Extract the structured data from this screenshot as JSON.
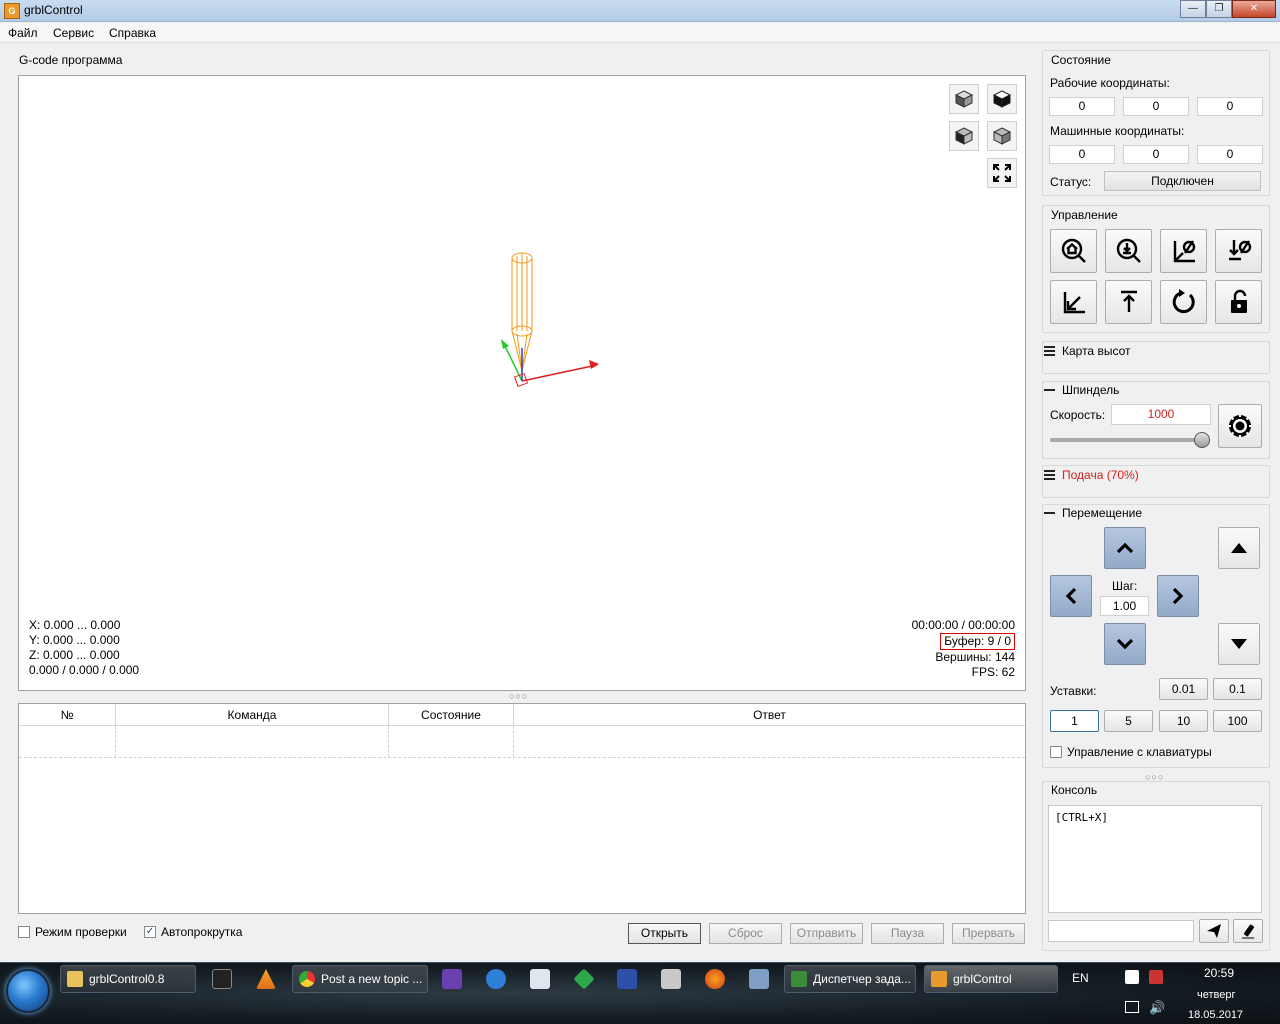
{
  "window": {
    "title": "grblControl",
    "icon_text": "G"
  },
  "menu": {
    "file": "Файл",
    "service": "Сервис",
    "help": "Справка"
  },
  "gcode": {
    "label": "G-code программа",
    "info_left": {
      "x": "X: 0.000 ... 0.000",
      "y": "Y: 0.000 ... 0.000",
      "z": "Z: 0.000 ... 0.000",
      "sizes": "0.000 / 0.000 / 0.000"
    },
    "info_right": {
      "time": "00:00:00 / 00:00:00",
      "buffer": "Буфер: 9 / 0",
      "vertices": "Вершины: 144",
      "fps": "FPS: 62"
    }
  },
  "table": {
    "columns": [
      "№",
      "Команда",
      "Состояние",
      "Ответ"
    ]
  },
  "bottom": {
    "check_mode": "Режим проверки",
    "autoscroll": "Автопрокрутка",
    "autoscroll_checked": true,
    "buttons": {
      "open": "Открыть",
      "reset": "Сброс",
      "send": "Отправить",
      "pause": "Пауза",
      "abort": "Прервать"
    }
  },
  "state": {
    "title": "Состояние",
    "work_label": "Рабочие координаты:",
    "work_coords": [
      "0",
      "0",
      "0"
    ],
    "machine_label": "Машинные координаты:",
    "machine_coords": [
      "0",
      "0",
      "0"
    ],
    "status_label": "Статус:",
    "status_value": "Подключен"
  },
  "control": {
    "title": "Управление"
  },
  "heightmap": {
    "title": "Карта высот"
  },
  "spindle": {
    "title": "Шпиндель",
    "speed_label": "Скорость:",
    "speed_value": "1000",
    "slider_fraction": 1.0
  },
  "feed": {
    "title": "Подача (70%)"
  },
  "jog": {
    "title": "Перемещение",
    "step_label": "Шаг:",
    "step_value": "1.00",
    "presets_label": "Уставки:",
    "presets_top": [
      "0.01",
      "0.1"
    ],
    "presets_bottom": [
      "1",
      "5",
      "10",
      "100"
    ],
    "keyboard_label": "Управление с клавиатуры"
  },
  "console": {
    "title": "Консоль",
    "output": "[CTRL+X]"
  },
  "taskbar": {
    "items": [
      "grblControl0.8",
      "Post a new topic ...",
      "Диспетчер зада...",
      "grblControl"
    ],
    "lang": "EN",
    "time": "20:59",
    "day": "четверг",
    "date": "18.05.2017"
  },
  "colors": {
    "feed_red": "#d42020",
    "speed_red": "#d42020",
    "jog_blue": "#9fb4d2"
  }
}
